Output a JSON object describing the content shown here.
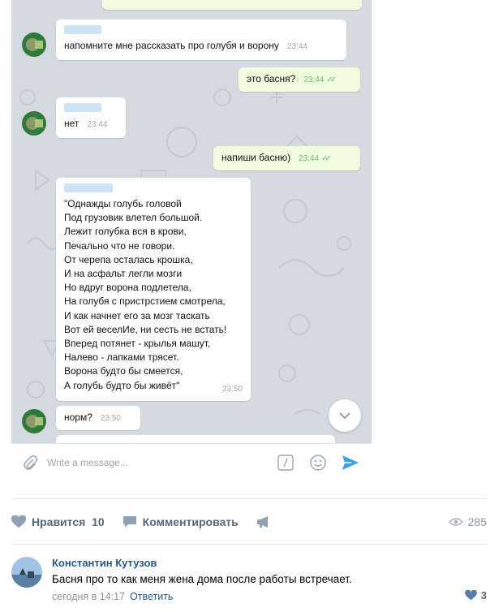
{
  "chat": {
    "messages": [
      {
        "from": "in",
        "text": "напомните мне рассказать про голубя и ворону",
        "time": "23:44"
      },
      {
        "from": "out",
        "text": "это басня?",
        "time": "23:44"
      },
      {
        "from": "in",
        "text": "нет",
        "time": "23:44"
      },
      {
        "from": "out",
        "text": "напиши басню)",
        "time": "23:44"
      },
      {
        "from": "in",
        "time": "23:50",
        "lines": [
          "\"Однажды голубь головой",
          "Под грузовик влетел большой.",
          "Лежит голубка вся в крови,",
          "Печально что не говори.",
          "От черепа осталась крошка,",
          "И на асфальт легли мозги",
          "Но вдруг ворона подлетела,",
          "На голубя с пристрстием смотрела,",
          "И как начнет его за мозг таскать",
          "Вот ей веселИе, ни сесть не встать!",
          "Вперед потянет - крылья машут,",
          "Налево - лапками трясет.",
          "Ворона будто бы смеется,",
          "А голубь будто бы живёт\""
        ]
      },
      {
        "from": "in",
        "text": "норм?",
        "time": "23:50"
      }
    ],
    "composer_placeholder": "Write a message..."
  },
  "post": {
    "like_label": "Нравится",
    "like_count": "10",
    "comment_label": "Комментировать",
    "views_count": "285"
  },
  "comment": {
    "author": "Константин Кутузов",
    "text": "Басня про то как меня жена дома после работы встречает.",
    "date": "сегодня в 14:17",
    "reply_label": "Ответить",
    "likes": "3"
  },
  "colors": {
    "chat_bg": "#d3dbe0",
    "incoming_bubble": "#ffffff",
    "outgoing_bubble": "#effdde",
    "send_icon": "#3fa0e0",
    "vk_link": "#2a5885",
    "vk_action": "#55677d"
  }
}
